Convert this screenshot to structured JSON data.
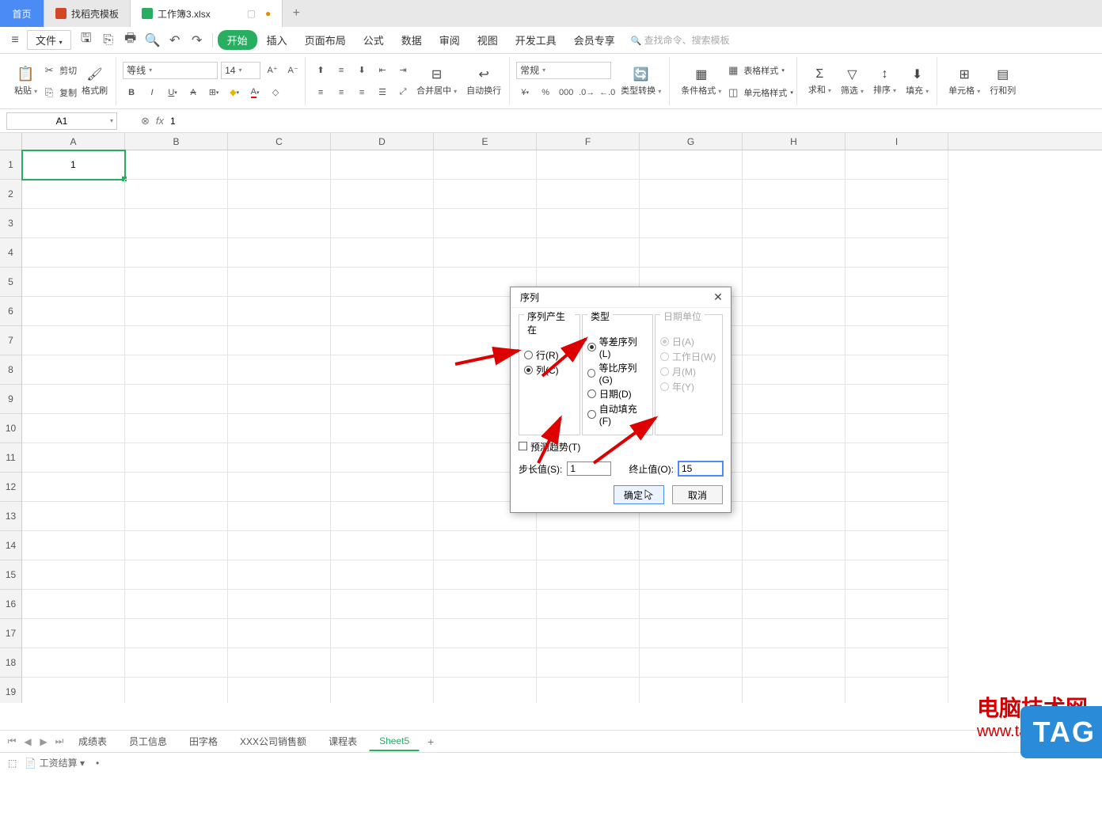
{
  "tabs": {
    "home": "首页",
    "template": "找稻壳模板",
    "current": "工作簿3.xlsx"
  },
  "menu": {
    "file": "文件",
    "start": "开始",
    "insert": "插入",
    "page": "页面布局",
    "formula": "公式",
    "data": "数据",
    "review": "审阅",
    "view": "视图",
    "dev": "开发工具",
    "member": "会员专享",
    "search_ph": "查找命令、搜索模板"
  },
  "ribbon": {
    "paste": "粘贴",
    "cut": "剪切",
    "copy": "复制",
    "fmt_painter": "格式刷",
    "font_name": "等线",
    "font_size": "14",
    "merge": "合并居中",
    "wrap": "自动换行",
    "format": "常规",
    "type_convert": "类型转换",
    "cond_fmt": "条件格式",
    "table_style": "表格样式",
    "cell_style": "单元格样式",
    "sum": "求和",
    "filter": "筛选",
    "sort": "排序",
    "fill": "填充",
    "cell": "单元格",
    "rowcol": "行和列"
  },
  "namebox": "A1",
  "formula": "1",
  "columns": [
    "A",
    "B",
    "C",
    "D",
    "E",
    "F",
    "G",
    "H",
    "I"
  ],
  "rows_count": 19,
  "cellA1": "1",
  "sheets": {
    "nav": [
      "成绩表",
      "员工信息",
      "田字格",
      "XXX公司销售额",
      "课程表",
      "Sheet5"
    ],
    "active": 5
  },
  "status": {
    "calc": "工资结算"
  },
  "dialog": {
    "title": "序列",
    "grp_pos": "序列产生在",
    "opt_row": "行(R)",
    "opt_col": "列(C)",
    "grp_type": "类型",
    "opt_arith": "等差序列(L)",
    "opt_geom": "等比序列(G)",
    "opt_date": "日期(D)",
    "opt_auto": "自动填充(F)",
    "grp_dateunit": "日期单位",
    "opt_day": "日(A)",
    "opt_work": "工作日(W)",
    "opt_month": "月(M)",
    "opt_year": "年(Y)",
    "predict": "预测趋势(T)",
    "step_lbl": "步长值(S):",
    "step_val": "1",
    "stop_lbl": "终止值(O):",
    "stop_val": "15",
    "ok": "确定",
    "cancel": "取消"
  },
  "watermark": {
    "l1": "电脑技术网",
    "l2": "www.tagxp.com",
    "tag": "TAG"
  }
}
